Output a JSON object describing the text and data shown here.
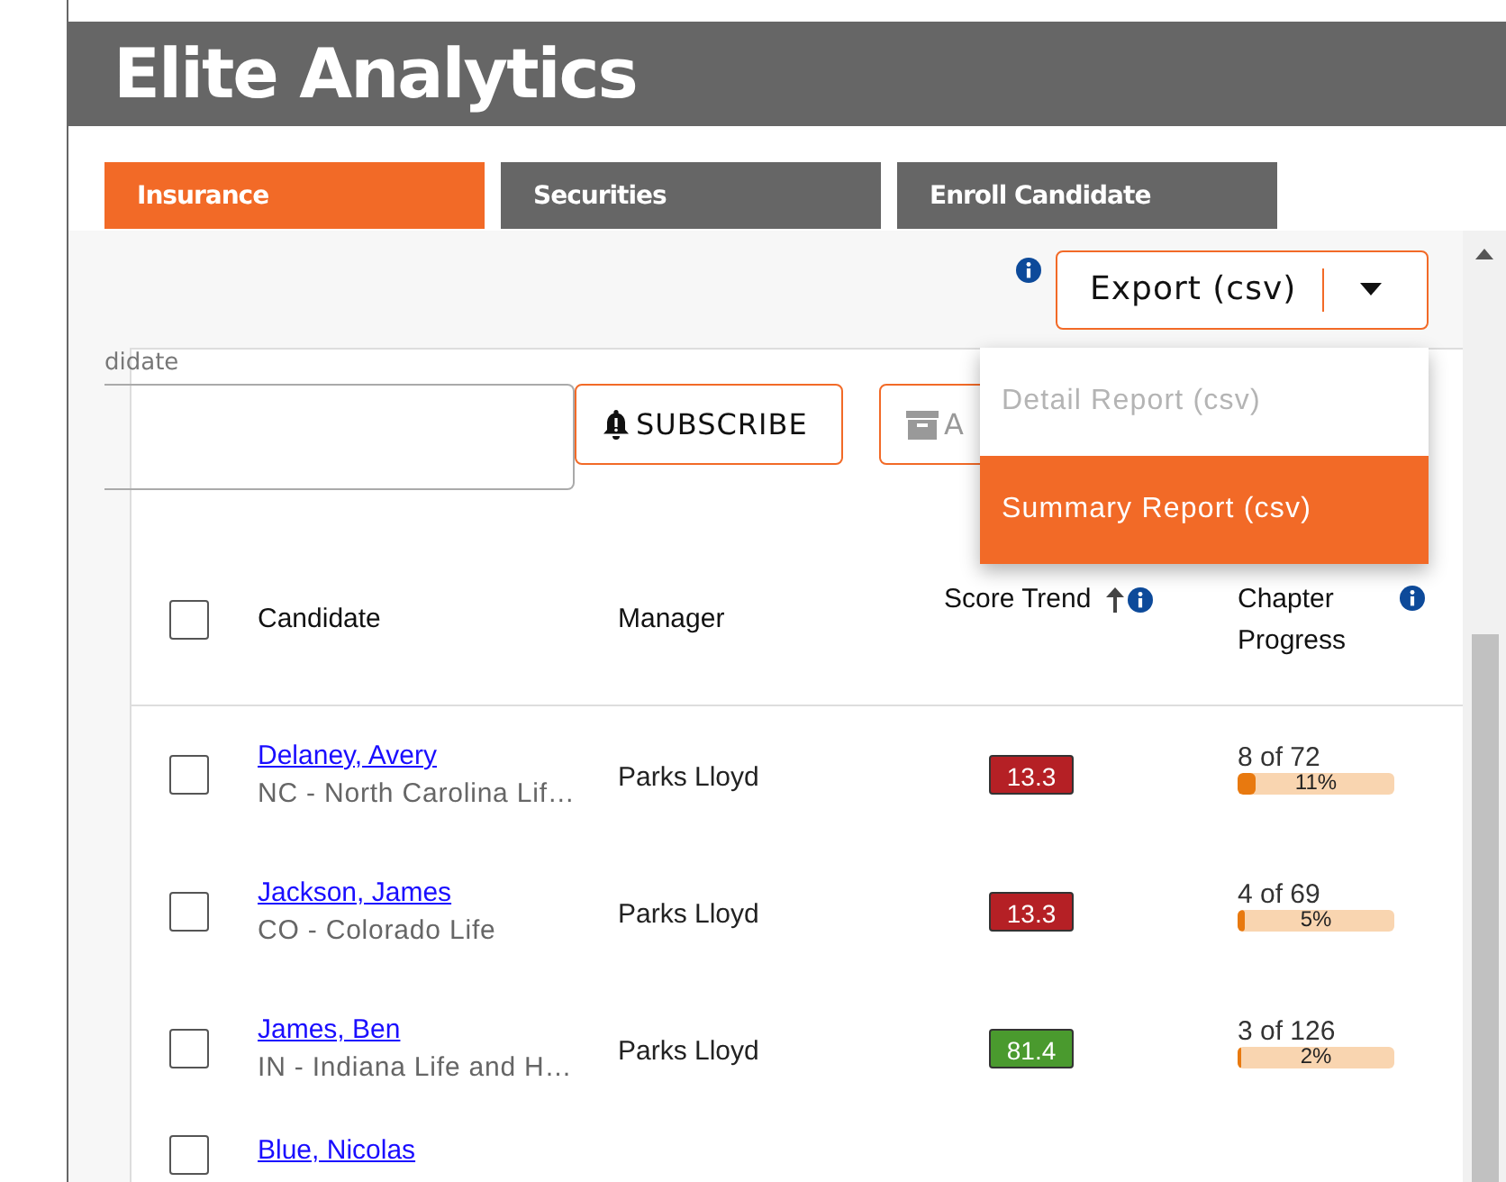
{
  "header": {
    "title": "Elite Analytics"
  },
  "tabs": [
    {
      "label": "Insurance",
      "selected": true
    },
    {
      "label": "Securities",
      "selected": false
    },
    {
      "label": "Enroll Candidate",
      "selected": false
    }
  ],
  "export": {
    "label": "Export (csv)",
    "menu": [
      {
        "label": "Detail Report (csv)",
        "selected": false,
        "disabled": true
      },
      {
        "label": "Summary Report (csv)",
        "selected": true,
        "disabled": false
      }
    ]
  },
  "filter": {
    "label": "didate",
    "subscribe": "SUBSCRIBE",
    "archive": "A"
  },
  "table": {
    "columns": [
      "Candidate",
      "Manager",
      "Score Trend",
      "Chapter Progress"
    ],
    "header_checked": false,
    "rows": [
      {
        "name": "Delaney, Avery",
        "state": "NC - North Carolina Lif…",
        "manager": "Parks Lloyd",
        "score": "13.3",
        "color": "#b52025",
        "chapters": "8 of 72",
        "level": 0.11,
        "percent": "11%",
        "checked": false
      },
      {
        "name": "Jackson, James",
        "state": "CO - Colorado Life",
        "manager": "Parks Lloyd",
        "score": "13.3",
        "color": "#b52025",
        "chapters": "4 of 69",
        "level": 0.05,
        "percent": "5%",
        "checked": false
      },
      {
        "name": "James, Ben",
        "state": "IN - Indiana Life and H…",
        "manager": "Parks Lloyd",
        "score": "81.4",
        "color": "#4a9a2e",
        "chapters": "3 of 126",
        "level": 0.02,
        "percent": "2%",
        "checked": false
      },
      {
        "name": "Blue, Nicolas",
        "checked": false
      }
    ]
  }
}
